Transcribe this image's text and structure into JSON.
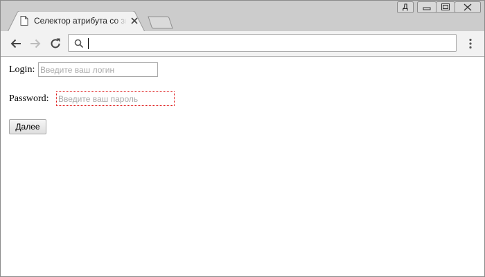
{
  "browser": {
    "tab": {
      "title": "Селектор атрибута со значением"
    },
    "window_controls": {
      "user_badge": "Д"
    }
  },
  "form": {
    "login": {
      "label": "Login:",
      "placeholder": "Введите ваш логин",
      "value": ""
    },
    "password": {
      "label": "Password:",
      "placeholder": "Введите ваш пароль",
      "value": ""
    },
    "submit_label": "Далее"
  }
}
